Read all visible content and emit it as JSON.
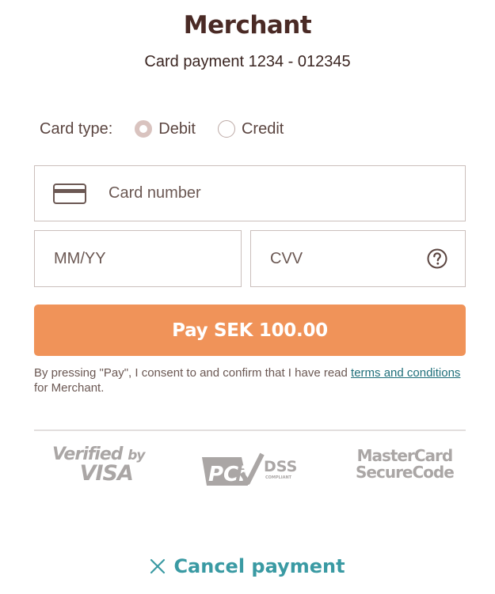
{
  "header": {
    "merchant": "Merchant",
    "payment_ref": "Card payment 1234 - 012345"
  },
  "card_type": {
    "label": "Card type:",
    "options": [
      {
        "label": "Debit",
        "selected": true
      },
      {
        "label": "Credit",
        "selected": false
      }
    ]
  },
  "form": {
    "card_number_placeholder": "Card number",
    "expiry_placeholder": "MM/YY",
    "cvv_placeholder": "CVV",
    "card_icon": "credit-card-icon",
    "cvv_help_icon": "question-circle-icon"
  },
  "pay_button": {
    "label": "Pay SEK 100.00"
  },
  "consent": {
    "prefix": "By pressing \"Pay\", I consent to and confirm that I have read ",
    "link": "terms and conditions",
    "suffix": " for Merchant."
  },
  "logos": {
    "visa_line1": "Verified",
    "visa_by": "by",
    "visa_line2": "VISA",
    "pci_text": "PCi",
    "pci_dss": "DSS",
    "pci_compliant": "COMPLIANT",
    "mc_line1": "MasterCard",
    "mc_line2": "SecureCode"
  },
  "cancel": {
    "label": "Cancel payment",
    "icon": "close-icon"
  },
  "colors": {
    "accent": "#f09359",
    "link": "#1f6f7a",
    "cancel": "#3a9aa3",
    "title": "#4a2a25"
  }
}
